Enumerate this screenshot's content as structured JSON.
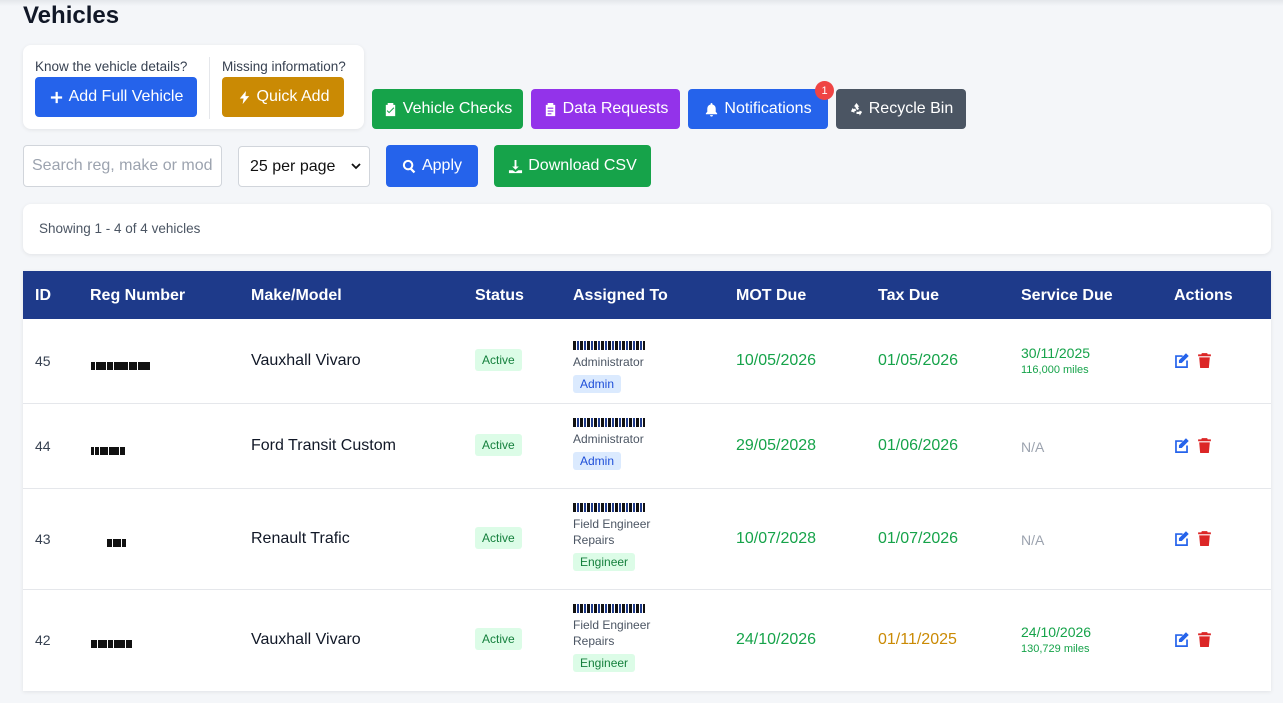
{
  "page": {
    "title": "Vehicles"
  },
  "add_card": {
    "full_hint": "Know the vehicle details?",
    "full_label": "Add Full Vehicle",
    "quick_hint": "Missing information?",
    "quick_label": "Quick Add"
  },
  "toolbar": {
    "vehicle_checks": "Vehicle Checks",
    "data_requests": "Data Requests",
    "notifications": "Notifications",
    "notifications_count": "1",
    "recycle_bin": "Recycle Bin"
  },
  "filters": {
    "search_placeholder": "Search reg, make or model",
    "per_page": "25 per page",
    "apply": "Apply",
    "download_csv": "Download CSV"
  },
  "summary": {
    "showing": "Showing 1 - 4 of 4 vehicles"
  },
  "table": {
    "headers": [
      "ID",
      "Reg Number",
      "Make/Model",
      "Status",
      "Assigned To",
      "MOT Due",
      "Tax Due",
      "Service Due",
      "Actions"
    ],
    "rows": [
      {
        "id": "45",
        "make": "Vauxhall Vivaro",
        "status": "Active",
        "role_lines": [
          "Administrator"
        ],
        "badge": "Admin",
        "mot": "10/05/2026",
        "tax": "01/05/2026",
        "service_date": "30/11/2025",
        "service_miles": "116,000 miles"
      },
      {
        "id": "44",
        "make": "Ford Transit Custom",
        "status": "Active",
        "role_lines": [
          "Administrator"
        ],
        "badge": "Admin",
        "mot": "29/05/2028",
        "tax": "01/06/2026",
        "service_na": "N/A"
      },
      {
        "id": "43",
        "make": "Renault Trafic",
        "status": "Active",
        "role_lines": [
          "Field Engineer",
          "Repairs"
        ],
        "badge": "Engineer",
        "mot": "10/07/2028",
        "tax": "01/07/2026",
        "service_na": "N/A"
      },
      {
        "id": "42",
        "make": "Vauxhall Vivaro",
        "status": "Active",
        "role_lines": [
          "Field Engineer",
          "Repairs"
        ],
        "badge": "Engineer",
        "mot": "24/10/2026",
        "tax": "01/11/2025",
        "service_date": "24/10/2026",
        "service_miles": "130,729 miles"
      }
    ]
  },
  "colors": {
    "header_bg": "#1e3a8a",
    "primary": "#2563eb",
    "success": "#16a34a",
    "warning": "#ca8a04",
    "purple": "#9333ea",
    "danger": "#dc2626"
  }
}
